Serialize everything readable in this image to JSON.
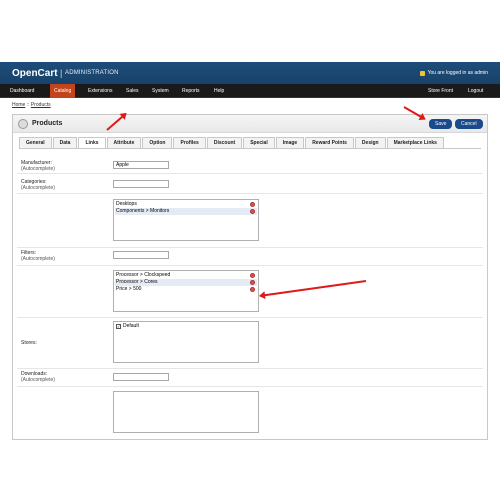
{
  "header": {
    "brand": "OpenCart",
    "separator": "|",
    "subtitle": "ADMINISTRATION",
    "logged_text": "You are logged in as admin"
  },
  "menu": {
    "items": [
      {
        "label": "Dashboard"
      },
      {
        "label": "Catalog"
      },
      {
        "label": "Extensions"
      },
      {
        "label": "Sales"
      },
      {
        "label": "System"
      },
      {
        "label": "Reports"
      },
      {
        "label": "Help"
      }
    ],
    "right": [
      {
        "label": "Store Front"
      },
      {
        "label": "Logout"
      }
    ]
  },
  "breadcrumb": {
    "home": "Home",
    "separator": "::",
    "current": "Products"
  },
  "panel": {
    "title": "Products",
    "save_label": "Save",
    "cancel_label": "Cancel"
  },
  "tabs": [
    "General",
    "Data",
    "Links",
    "Attribute",
    "Option",
    "Profiles",
    "Discount",
    "Special",
    "Image",
    "Reward Points",
    "Design",
    "Marketplace Links"
  ],
  "active_tab": "Links",
  "form": {
    "manufacturer": {
      "label": "Manufacturer:",
      "help": "(Autocomplete)",
      "value": "Apple"
    },
    "categories": {
      "label": "Categories:",
      "help": "(Autocomplete)",
      "value": "",
      "items": [
        "Desktops",
        "Components > Monitors"
      ]
    },
    "filters": {
      "label": "Filters:",
      "help": "(Autocomplete)",
      "value": "",
      "items": [
        "Processor > Clockspeed",
        "Processor > Cores",
        "Price > 500"
      ]
    },
    "stores": {
      "label": "Stores:",
      "items": [
        "Default"
      ]
    },
    "downloads": {
      "label": "Downloads:",
      "help": "(Autocomplete)",
      "value": ""
    }
  },
  "colors": {
    "header_blue": "#1e4d7b",
    "menu_active": "#c3431a",
    "button_blue": "#1a4a8b",
    "arrow_red": "#e01919",
    "remove_red": "#d9534f"
  },
  "icons": {
    "lock": "lock-icon",
    "gear": "gear-icon",
    "remove": "remove-circle-icon",
    "checkbox": "checkbox-checked-icon"
  }
}
